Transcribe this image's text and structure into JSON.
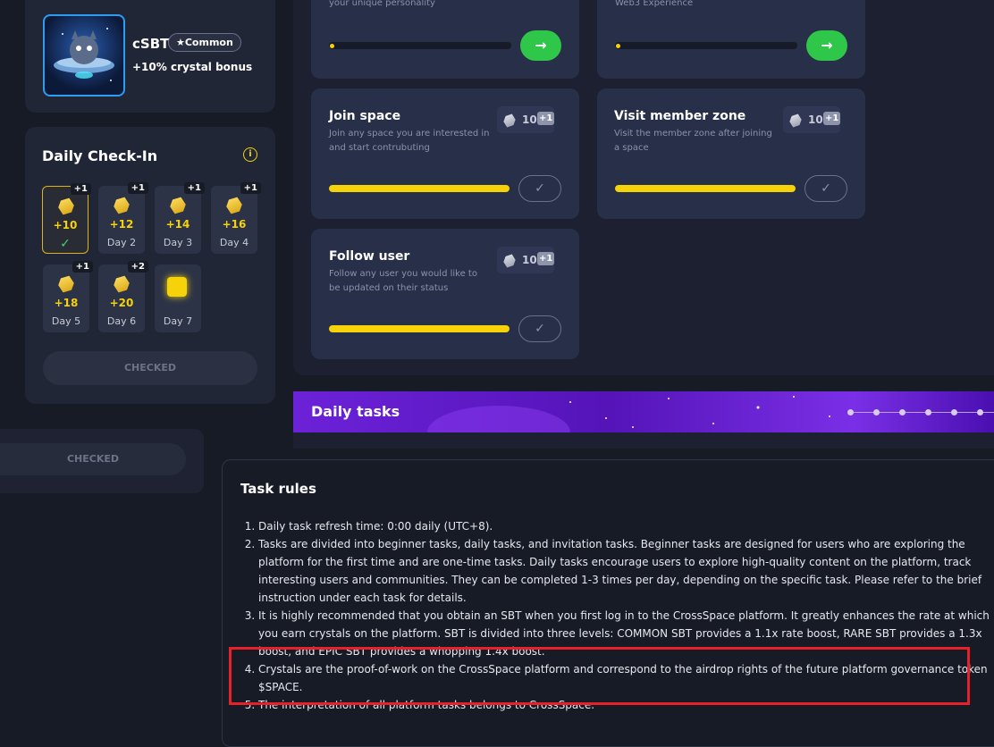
{
  "sbt": {
    "name": "cSBT",
    "rarity": "★Common",
    "bonus": "+10% crystal bonus"
  },
  "daily_checkin": {
    "title": "Daily Check-In",
    "days": [
      {
        "amount": "+10",
        "label": "",
        "bonus": "+1",
        "checked": true
      },
      {
        "amount": "+12",
        "label": "Day 2",
        "bonus": "+1"
      },
      {
        "amount": "+14",
        "label": "Day 3",
        "bonus": "+1"
      },
      {
        "amount": "+16",
        "label": "Day 4",
        "bonus": "+1"
      },
      {
        "amount": "+18",
        "label": "Day 5",
        "bonus": "+1"
      },
      {
        "amount": "+20",
        "label": "Day 6",
        "bonus": "+2"
      },
      {
        "amount": "",
        "label": "Day 7",
        "bonus": ""
      }
    ],
    "checked_label": "CHECKED",
    "ghost_checked_label": "CHECKED"
  },
  "tasks": {
    "top_left_desc": "your unique personality",
    "top_right_desc": "Web3 Experience",
    "go_icon": "arrow-right-icon",
    "done_icon": "check-icon",
    "items": [
      {
        "title": "Join space",
        "desc": "Join any space you are interested in and start contrubuting",
        "reward": "10",
        "bonus": "+1",
        "progress": 1.0
      },
      {
        "title": "Visit member zone",
        "desc": "Visit the member zone after joining a space",
        "reward": "10",
        "bonus": "+1",
        "progress": 1.0
      },
      {
        "title": "Follow user",
        "desc": "Follow any user you would like to be updated on their status",
        "reward": "10",
        "bonus": "+1",
        "progress": 1.0
      }
    ]
  },
  "daily_tasks_banner": {
    "title": "Daily tasks"
  },
  "task_rules": {
    "title": "Task rules",
    "items": [
      "Daily task refresh time: 0:00 daily (UTC+8).",
      "Tasks are divided into beginner tasks, daily tasks, and invitation tasks. Beginner tasks are designed for users who are exploring the platform for the first time and are one-time tasks. Daily tasks encourage users to explore high-quality content on the platform, track interesting users and communities. They can be completed 1-3 times per day, depending on the specific task. Please refer to the brief instruction under each task for details.",
      "It is highly recommended that you obtain an SBT when you first log in to the CrossSpace platform. It greatly enhances the rate at which you earn crystals on the platform. SBT is divided into three levels: COMMON SBT provides a 1.1x rate boost, RARE SBT provides a 1.3x boost, and EPIC SBT provides a whopping 1.4x boost.",
      "Crystals are the proof-of-work on the CrossSpace platform and correspond to the airdrop rights of the future platform governance token $SPACE.",
      "The interpretation of all platform tasks belongs to CrossSpace."
    ]
  },
  "colors": {
    "accent_yellow": "#f5d20a",
    "go_green": "#2fc74a",
    "highlight_red": "#e8202a"
  }
}
